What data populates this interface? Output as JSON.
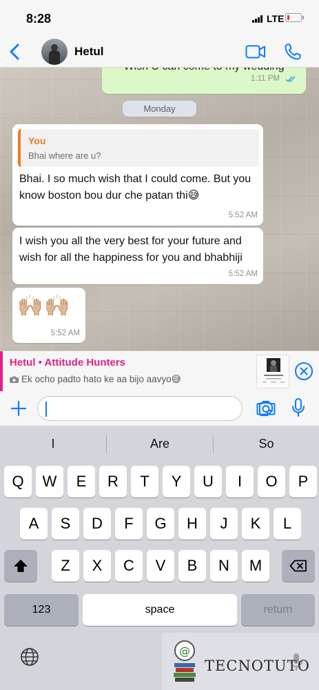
{
  "status_bar": {
    "time": "8:28",
    "network": "LTE",
    "battery_level": 0.15
  },
  "header": {
    "contact_name": "Hetul"
  },
  "messages": [
    {
      "direction": "outgoing",
      "text": "Wish U can come to my wedding",
      "time": "1:11 PM"
    },
    {
      "direction": "incoming",
      "quote_author": "You",
      "quote_text": "Bhai where are u?",
      "text": "Bhai. I so much wish that I could come. But you know boston bou dur che patan thi😅",
      "time": "5:52 AM"
    },
    {
      "direction": "incoming",
      "text": "I wish you all the very best for your future and wish for all the happiness for you and bhabhiji",
      "time": "5:52 AM"
    },
    {
      "direction": "incoming",
      "text": "🙌🏼🙌🏼",
      "time": "5:52 AM"
    }
  ],
  "day_separator": "Monday",
  "reply_preview": {
    "title": "Hetul • Attitude Hunters",
    "text": "Ek ocho padto hato ke aa bijo aavyo😅"
  },
  "input": {
    "value": "",
    "placeholder": ""
  },
  "keyboard": {
    "suggestions": [
      "I",
      "Are",
      "So"
    ],
    "row1": [
      "Q",
      "W",
      "E",
      "R",
      "T",
      "Y",
      "U",
      "I",
      "O",
      "P"
    ],
    "row2": [
      "A",
      "S",
      "D",
      "F",
      "G",
      "H",
      "J",
      "K",
      "L"
    ],
    "row3": [
      "Z",
      "X",
      "C",
      "V",
      "B",
      "N",
      "M"
    ],
    "numbers_label": "123",
    "space_label": "space",
    "return_label": "return"
  },
  "watermark": {
    "text": "TECNOTUTO"
  },
  "colors": {
    "accent": "#0a7cff",
    "reply_accent": "#e0218a",
    "quote_accent": "#f07b1d",
    "outgoing_bubble": "#dcf8c6"
  }
}
